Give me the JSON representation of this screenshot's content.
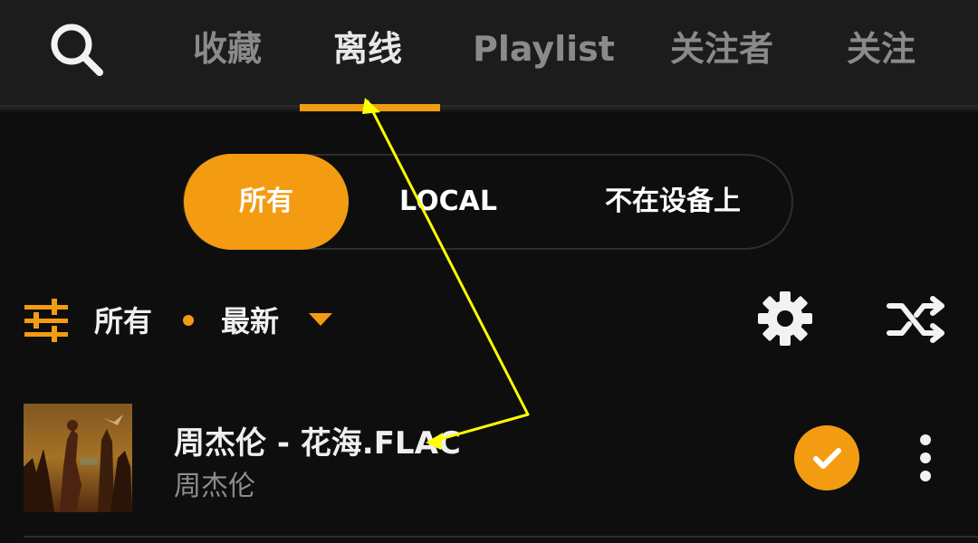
{
  "header": {
    "search_icon": "search-icon",
    "tabs": [
      {
        "label": "收藏",
        "active": false
      },
      {
        "label": "离线",
        "active": true
      },
      {
        "label": "Playlist",
        "active": false
      },
      {
        "label": "关注者",
        "active": false
      },
      {
        "label": "关注",
        "active": false
      }
    ],
    "accent_color": "#f39c12"
  },
  "segment": {
    "options": [
      "所有",
      "LOCAL",
      "不在设备上"
    ],
    "selected": "所有"
  },
  "filter_bar": {
    "filter_icon": "filter-sliders-icon",
    "filter_label": "所有",
    "sort_label": "最新",
    "settings_icon": "gear-icon",
    "shuffle_icon": "shuffle-icon"
  },
  "tracks": [
    {
      "title": "周杰伦 - 花海.FLAC",
      "artist": "周杰伦",
      "downloaded": true
    }
  ]
}
